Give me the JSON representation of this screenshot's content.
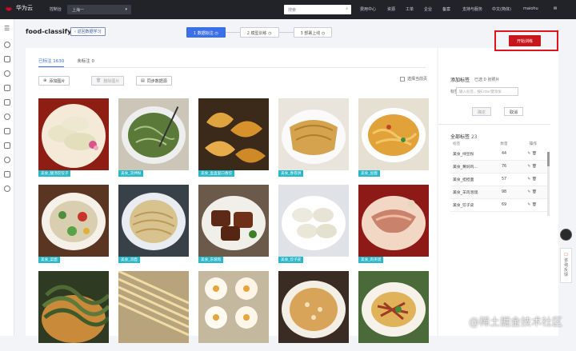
{
  "topbar": {
    "brand": "华为云",
    "menu": "控制台",
    "region": "上海一",
    "search_placeholder": "搜索",
    "nav": [
      "费用中心",
      "资源",
      "工单",
      "企业",
      "备案",
      "支持与服务",
      "中文(简体)",
      "maiohu"
    ]
  },
  "project": {
    "title": "food-classify",
    "back_label": "返回数据学习"
  },
  "steps": [
    "1 数据标注",
    "2 模型训练",
    "3 部署上线"
  ],
  "tabs": [
    "已标注 1630",
    "未标注 0"
  ],
  "toolbar": {
    "add_images": "添加图片",
    "delete": "删除图片",
    "sync": "同步数据源",
    "select_all": "选择当前页"
  },
  "images": [
    {
      "label": "美食_酸汤饺饺子",
      "kind": "dumplings-plate"
    },
    {
      "label": "美食_凉拌粉",
      "kind": "green-noodles"
    },
    {
      "label": "美食_盒盒里口香饺",
      "kind": "fried-dumplings"
    },
    {
      "label": "美食_春卷饼",
      "kind": "roll-cake"
    },
    {
      "label": "美食_豆面",
      "kind": "yellow-noodles"
    },
    {
      "label": "美食_菜面",
      "kind": "veggie-noodles"
    },
    {
      "label": "美食_凉面",
      "kind": "cold-noodles"
    },
    {
      "label": "美食_东坡肉",
      "kind": "braised-pork"
    },
    {
      "label": "美食_饺子皮",
      "kind": "white-dumplings"
    },
    {
      "label": "美食_肉夹馍",
      "kind": "meat-bun"
    },
    {
      "label": "",
      "kind": "dark-noodles"
    },
    {
      "label": "",
      "kind": "raw-noodles"
    },
    {
      "label": "",
      "kind": "buns"
    },
    {
      "label": "",
      "kind": "porridge"
    },
    {
      "label": "",
      "kind": "stir-fry"
    }
  ],
  "panel": {
    "train_button": "开始训练",
    "add_label_title": "添加标签",
    "add_label_count": "已选 0 张照片",
    "label_name": "标签名",
    "input_placeholder": "输入标签，按Enter键添加",
    "confirm": "确定",
    "cancel": "取消",
    "all_labels_title": "全部标签",
    "all_labels_count": "23",
    "columns": [
      "标签",
      "数量",
      "操作"
    ],
    "labels": [
      {
        "name": "美食_绿豆粉",
        "count": "44"
      },
      {
        "name": "美食_黄焖鸡...",
        "count": "76"
      },
      {
        "name": "美食_担担面",
        "count": "57"
      },
      {
        "name": "美食_羊肉泡馍",
        "count": "98"
      },
      {
        "name": "美食_饺子皮",
        "count": "69"
      }
    ]
  },
  "float": {
    "feedback": "咨询反馈"
  },
  "watermark": "@稀土掘金技术社区",
  "colors": {
    "accent": "#3a6fe8",
    "label_bg": "#29b8c9",
    "train": "#c8161d",
    "topbar": "#212328"
  }
}
